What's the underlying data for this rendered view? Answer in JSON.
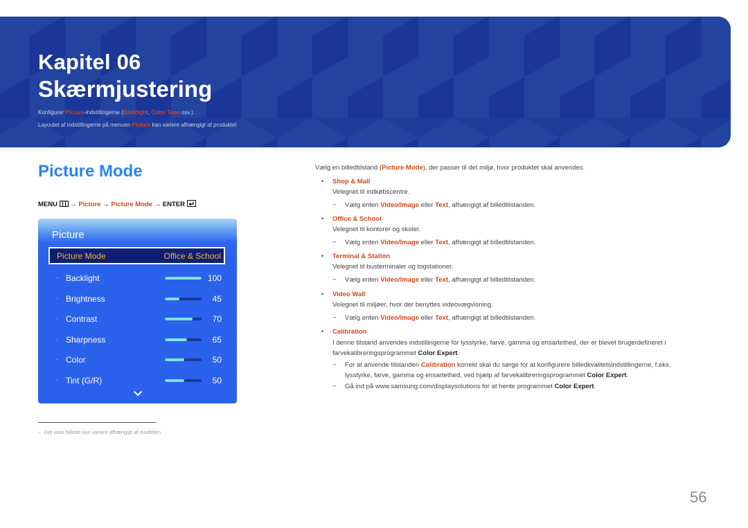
{
  "header": {
    "chapter_label": "Kapitel 06",
    "chapter_title": "Skærmjustering",
    "intro_line1": {
      "prefix": "Konfigurer ",
      "link1": "Picture",
      "mid": "-indstillingerne (",
      "link2": "Backlight",
      "sep": ", ",
      "link3": "Color Tone",
      "suffix": " osv.)."
    },
    "intro_line2": {
      "prefix": "Layoutet af indstillingerne på menuen ",
      "link": "Picture",
      "suffix": " kan variere afhængigt af produktet"
    },
    "colors": {
      "band": "#1e3c9a",
      "accent": "#d4461a"
    }
  },
  "section": {
    "title": "Picture Mode",
    "breadcrumb": {
      "menu": "MENU",
      "arrow": "→",
      "step1": "Picture",
      "step2": "Picture Mode",
      "enter": "ENTER"
    }
  },
  "osd": {
    "title": "Picture",
    "selected": {
      "label": "Picture Mode",
      "value": "Office & School"
    },
    "items": [
      {
        "label": "Backlight",
        "value": "100",
        "level": 1.0
      },
      {
        "label": "Brightness",
        "value": "45",
        "level": 0.4
      },
      {
        "label": "Contrast",
        "value": "70",
        "level": 0.76
      },
      {
        "label": "Sharpness",
        "value": "65",
        "level": 0.61
      },
      {
        "label": "Color",
        "value": "50",
        "level": 0.53
      },
      {
        "label": "Tint (G/R)",
        "value": "50",
        "level": 0.53
      }
    ],
    "bullet": "·"
  },
  "footnote": {
    "dash": "−",
    "text": "Det viste billede kan variere afhængigt af modellen."
  },
  "content": {
    "intro": {
      "prefix": "Vælg en billedtilstand (",
      "term": "Picture Mode",
      "suffix": "), der passer til det miljø, hvor produktet skal anvendes."
    },
    "bullet_char": "•",
    "dash_char": "−",
    "note_common": {
      "prefix": "Vælg enten ",
      "t1": "Video/Image",
      "mid": " eller ",
      "t2": "Text",
      "suffix": ", afhængigt af billedtilstanden."
    },
    "modes": [
      {
        "name": "Shop & Mall",
        "desc": "Velegnet til indkøbscentre."
      },
      {
        "name": "Office & School",
        "desc": "Velegnet til kontorer og skoler."
      },
      {
        "name": "Terminal & Station",
        "desc": "Velegnet til busterminaler og togstationer."
      },
      {
        "name": "Video Wall",
        "desc": "Velegnet til miljøer, hvor der benyttes videovægvisning."
      }
    ],
    "calibration": {
      "name": "Calibration",
      "desc_line1": "I denne tilstand anvendes indstillingerne for lysstyrke, farve, gamma og ensartethed, der er blevet brugerdefineret i",
      "desc_line2_prefix": "farvekalibreringsprogrammet ",
      "desc_line2_bold": "Color Expert",
      "desc_line2_suffix": ".",
      "note1_prefix": "For at anvende tilstanden ",
      "note1_term": "Calibration",
      "note1_suffix": " korrekt skal du sørge for at konfigurere billedkvalitetsindstillingerne, f.eks.",
      "note1_line2_prefix": "lysstyrke, farve, gamma og ensartethed, ved hjælp af farvekalibreringsprogrammet ",
      "note1_line2_bold": "Color Expert",
      "note1_line2_suffix": ".",
      "note2_prefix": "Gå ind på www.samsung.com/displaysolutions for at hente programmet ",
      "note2_bold": "Color Expert",
      "note2_suffix": "."
    }
  },
  "page_number": "56"
}
